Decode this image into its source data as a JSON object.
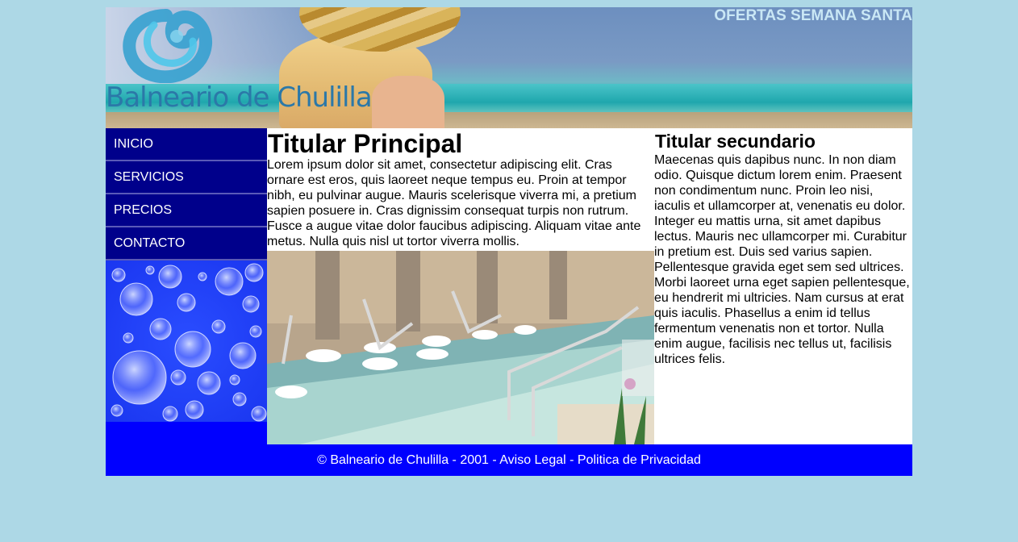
{
  "header": {
    "site_name": "Balneario de Chulilla",
    "promo": "OFERTAS SEMANA SANTA"
  },
  "nav": {
    "items": [
      "INICIO",
      "SERVICIOS",
      "PRECIOS",
      "CONTACTO"
    ]
  },
  "main": {
    "title": "Titular Principal",
    "body": "Lorem ipsum dolor sit amet, consectetur adipiscing elit. Cras ornare est eros, quis laoreet neque tempus eu. Proin at tempor nibh, eu pulvinar augue. Mauris scelerisque viverra mi, a pretium sapien posuere in. Cras dignissim consequat turpis non rutrum. Fusce a augue vitae dolor faucibus adipiscing. Aliquam vitae ante metus. Nulla quis nisl ut tortor viverra mollis."
  },
  "side": {
    "title": "Titular secundario",
    "body": "Maecenas quis dapibus nunc. In non diam odio. Quisque dictum lorem enim. Praesent non condimentum nunc. Proin leo nisi, iaculis et ullamcorper at, venenatis eu dolor. Integer eu mattis urna, sit amet dapibus lectus. Mauris nec ullamcorper mi. Curabitur in pretium est. Duis sed varius sapien. Pellentesque gravida eget sem sed ultrices. Morbi laoreet urna eget sapien pellentesque, eu hendrerit mi ultricies. Nam cursus at erat quis iaculis. Phasellus a enim id tellus fermentum venenatis non et tortor. Nulla enim augue, facilisis nec tellus ut, facilisis ultrices felis."
  },
  "footer": {
    "text": "© Balneario de Chulilla - 2001 - Aviso Legal - Politica de Privacidad"
  },
  "colors": {
    "page_bg": "#add8e6",
    "nav_bg": "#00008b",
    "accent_blue": "#0000ff",
    "logo_blue": "#2b78a8"
  }
}
